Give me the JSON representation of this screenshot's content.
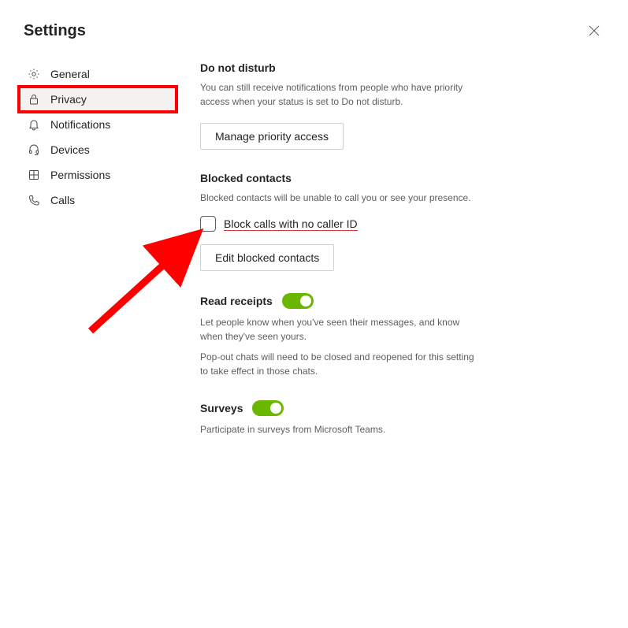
{
  "header": {
    "title": "Settings"
  },
  "sidebar": {
    "items": [
      {
        "label": "General",
        "icon": "gear-icon"
      },
      {
        "label": "Privacy",
        "icon": "lock-icon"
      },
      {
        "label": "Notifications",
        "icon": "bell-icon"
      },
      {
        "label": "Devices",
        "icon": "headset-icon"
      },
      {
        "label": "Permissions",
        "icon": "package-icon"
      },
      {
        "label": "Calls",
        "icon": "phone-icon"
      }
    ],
    "active_index": 1,
    "highlighted_index": 1
  },
  "main": {
    "dnd": {
      "heading": "Do not disturb",
      "description": "You can still receive notifications from people who have priority access when your status is set to Do not disturb.",
      "button": "Manage priority access"
    },
    "blocked": {
      "heading": "Blocked contacts",
      "description": "Blocked contacts will be unable to call you or see your presence.",
      "checkbox_label": "Block calls with no caller ID",
      "checkbox_checked": false,
      "button": "Edit blocked contacts"
    },
    "read_receipts": {
      "heading": "Read receipts",
      "toggle_on": true,
      "description1": "Let people know when you've seen their messages, and know when they've seen yours.",
      "description2": "Pop-out chats will need to be closed and reopened for this setting to take effect in those chats."
    },
    "surveys": {
      "heading": "Surveys",
      "toggle_on": true,
      "description": "Participate in surveys from Microsoft Teams."
    }
  },
  "annotations": {
    "red_highlight_on": "sidebar-item-privacy",
    "arrow_points_to": "block-no-caller-id-checkbox"
  }
}
